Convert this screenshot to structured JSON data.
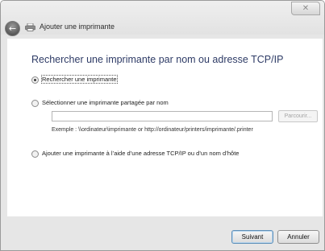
{
  "window": {
    "title": "Ajouter une imprimante",
    "close_label": "✕"
  },
  "main": {
    "heading": "Rechercher une imprimante par nom ou adresse TCP/IP",
    "options": [
      {
        "label": "Rechercher une imprimante",
        "selected": true
      },
      {
        "label": "Sélectionner une imprimante partagée par nom",
        "selected": false
      },
      {
        "label": "Ajouter une imprimante à l’aide d’une adresse TCP/IP ou d’un nom d’hôte",
        "selected": false
      }
    ],
    "shared_name_input": {
      "value": ""
    },
    "browse_label": "Parcourir...",
    "example_text": "Exemple : \\\\ordinateur\\imprimante or http://ordinateur/printers/imprimante/.printer"
  },
  "footer": {
    "next_label": "Suivant",
    "cancel_label": "Annuler"
  },
  "icons": {
    "back": "back-arrow-icon",
    "printer": "printer-icon",
    "close": "close-icon"
  }
}
